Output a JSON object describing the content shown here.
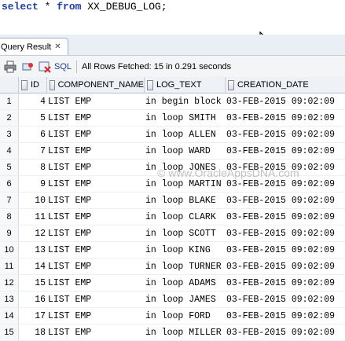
{
  "editor": {
    "sql_keyword_select": "select",
    "sql_star": " * ",
    "sql_keyword_from": "from",
    "sql_table": " XX_DEBUG_LOG;"
  },
  "tab": {
    "label": "Query Result",
    "close_icon": "close-icon"
  },
  "toolbar": {
    "sql_label": "SQL",
    "status": "All Rows Fetched: 15 in 0.291 seconds",
    "icons": [
      "print-icon",
      "pin-icon",
      "cancel-icon"
    ]
  },
  "grid": {
    "columns": [
      "ID",
      "COMPONENT_NAME",
      "LOG_TEXT",
      "CREATION_DATE"
    ],
    "rows": [
      {
        "n": "1",
        "id": "4",
        "comp": "LIST EMP",
        "log": "in begin block",
        "date": "03-FEB-2015 09:02:09"
      },
      {
        "n": "2",
        "id": "5",
        "comp": "LIST EMP",
        "log": "in loop SMITH",
        "date": "03-FEB-2015 09:02:09"
      },
      {
        "n": "3",
        "id": "6",
        "comp": "LIST EMP",
        "log": "in loop ALLEN",
        "date": "03-FEB-2015 09:02:09"
      },
      {
        "n": "4",
        "id": "7",
        "comp": "LIST EMP",
        "log": "in loop WARD",
        "date": "03-FEB-2015 09:02:09"
      },
      {
        "n": "5",
        "id": "8",
        "comp": "LIST EMP",
        "log": "in loop JONES",
        "date": "03-FEB-2015 09:02:09"
      },
      {
        "n": "6",
        "id": "9",
        "comp": "LIST EMP",
        "log": "in loop MARTIN",
        "date": "03-FEB-2015 09:02:09"
      },
      {
        "n": "7",
        "id": "10",
        "comp": "LIST EMP",
        "log": "in loop BLAKE",
        "date": "03-FEB-2015 09:02:09"
      },
      {
        "n": "8",
        "id": "11",
        "comp": "LIST EMP",
        "log": "in loop CLARK",
        "date": "03-FEB-2015 09:02:09"
      },
      {
        "n": "9",
        "id": "12",
        "comp": "LIST EMP",
        "log": "in loop SCOTT",
        "date": "03-FEB-2015 09:02:09"
      },
      {
        "n": "10",
        "id": "13",
        "comp": "LIST EMP",
        "log": "in loop KING",
        "date": "03-FEB-2015 09:02:09"
      },
      {
        "n": "11",
        "id": "14",
        "comp": "LIST EMP",
        "log": "in loop TURNER",
        "date": "03-FEB-2015 09:02:09"
      },
      {
        "n": "12",
        "id": "15",
        "comp": "LIST EMP",
        "log": "in loop ADAMS",
        "date": "03-FEB-2015 09:02:09"
      },
      {
        "n": "13",
        "id": "16",
        "comp": "LIST EMP",
        "log": "in loop JAMES",
        "date": "03-FEB-2015 09:02:09"
      },
      {
        "n": "14",
        "id": "17",
        "comp": "LIST EMP",
        "log": "in loop FORD",
        "date": "03-FEB-2015 09:02:09"
      },
      {
        "n": "15",
        "id": "18",
        "comp": "LIST EMP",
        "log": "in loop MILLER",
        "date": "03-FEB-2015 09:02:09"
      }
    ]
  },
  "watermark": "© www.OracleAppsDNA.com"
}
